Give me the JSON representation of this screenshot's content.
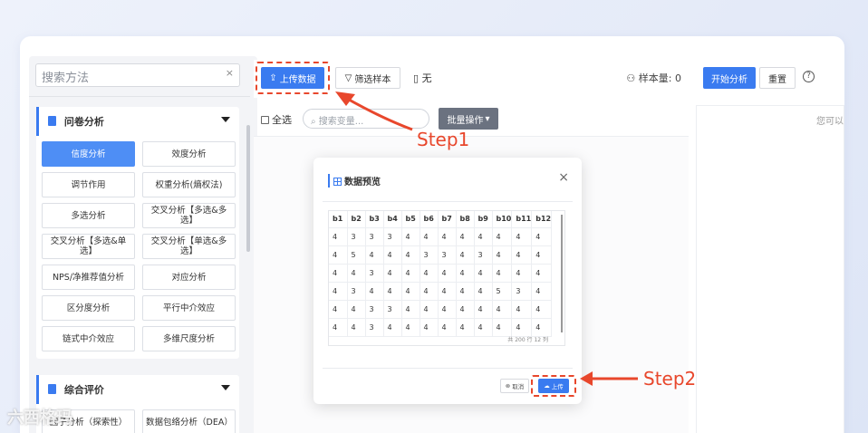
{
  "left_panel": {
    "search_placeholder": "搜索方法",
    "clear": "×",
    "groups": [
      {
        "title": "问卷分析",
        "methods": [
          "信度分析",
          "效度分析",
          "调节作用",
          "权重分析(熵权法)",
          "多选分析",
          "交叉分析【多选&多选】",
          "交叉分析【多选&单选】",
          "交叉分析【单选&多选】",
          "NPS/净推荐值分析",
          "对应分析",
          "区分度分析",
          "平行中介效应",
          "链式中介效应",
          "多维尺度分析"
        ],
        "active": "信度分析"
      },
      {
        "title": "综合评价",
        "methods": [
          "因子分析（探索性）",
          "数据包络分析（DEA）"
        ]
      }
    ]
  },
  "toolbar": {
    "upload_label": "上传数据",
    "filter_label": "筛选样本",
    "file_label": "无",
    "sample_label": "样本量: 0"
  },
  "sub_toolbar": {
    "select_all": "全选",
    "var_search_placeholder": "搜索变量...",
    "batch_label": "批量操作"
  },
  "right": {
    "start_label": "开始分析",
    "reset_label": "重置",
    "help": "?",
    "hint": "您可以"
  },
  "modal": {
    "title": "数据预览",
    "close": "×",
    "columns": [
      "b1",
      "b2",
      "b3",
      "b4",
      "b5",
      "b6",
      "b7",
      "b8",
      "b9",
      "b10",
      "b11",
      "b12"
    ],
    "rows": [
      [
        "4",
        "3",
        "3",
        "3",
        "4",
        "4",
        "4",
        "4",
        "4",
        "4",
        "4",
        "4"
      ],
      [
        "4",
        "5",
        "4",
        "4",
        "4",
        "3",
        "3",
        "4",
        "3",
        "4",
        "4",
        "4"
      ],
      [
        "4",
        "4",
        "3",
        "4",
        "4",
        "4",
        "4",
        "4",
        "4",
        "4",
        "4",
        "4"
      ],
      [
        "4",
        "3",
        "4",
        "4",
        "4",
        "4",
        "4",
        "4",
        "4",
        "5",
        "3",
        "4"
      ],
      [
        "4",
        "4",
        "3",
        "3",
        "4",
        "4",
        "4",
        "4",
        "4",
        "4",
        "4",
        "4"
      ],
      [
        "4",
        "4",
        "3",
        "4",
        "4",
        "4",
        "4",
        "4",
        "4",
        "4",
        "4",
        "4"
      ]
    ],
    "footer": "共 200 行 12 列",
    "cancel_label": "取消",
    "upload_label": "上传"
  },
  "annotations": {
    "step1": "Step1",
    "step2": "Step2",
    "accent": "#e8472c"
  },
  "watermark": "六西格玛"
}
